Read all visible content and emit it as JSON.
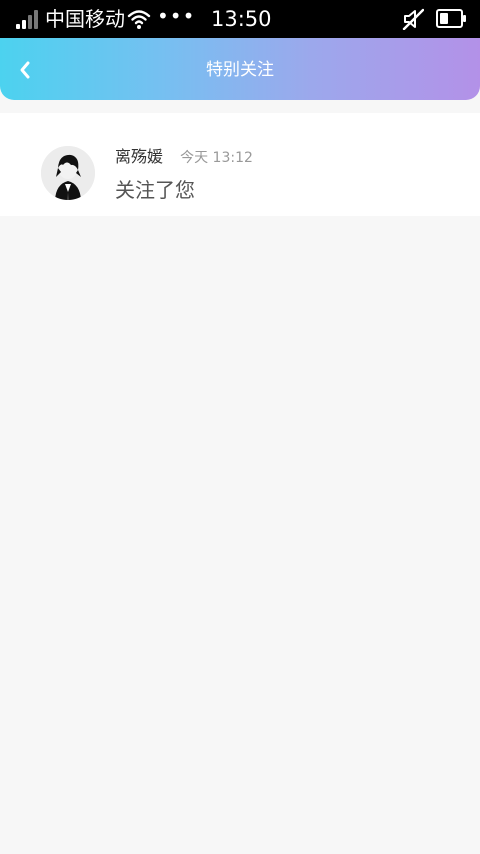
{
  "status_bar": {
    "carrier": "中国移动",
    "dots": "•••",
    "time": "13:50",
    "icons": [
      "signal-icon",
      "wifi-icon",
      "mute-icon",
      "battery-icon"
    ]
  },
  "header": {
    "title": "特别关注",
    "back_icon": "chevron-left-icon",
    "gradient_start": "#4cd2ef",
    "gradient_end": "#b391e8"
  },
  "notifications": [
    {
      "name": "离殇媛",
      "time": "今天 13:12",
      "message": "关注了您",
      "avatar_icon": "avatar-image"
    }
  ],
  "colors": {
    "page_bg": "#f7f7f7",
    "card_bg": "#ffffff",
    "primary_text": "#333333",
    "secondary_text": "#999999"
  }
}
